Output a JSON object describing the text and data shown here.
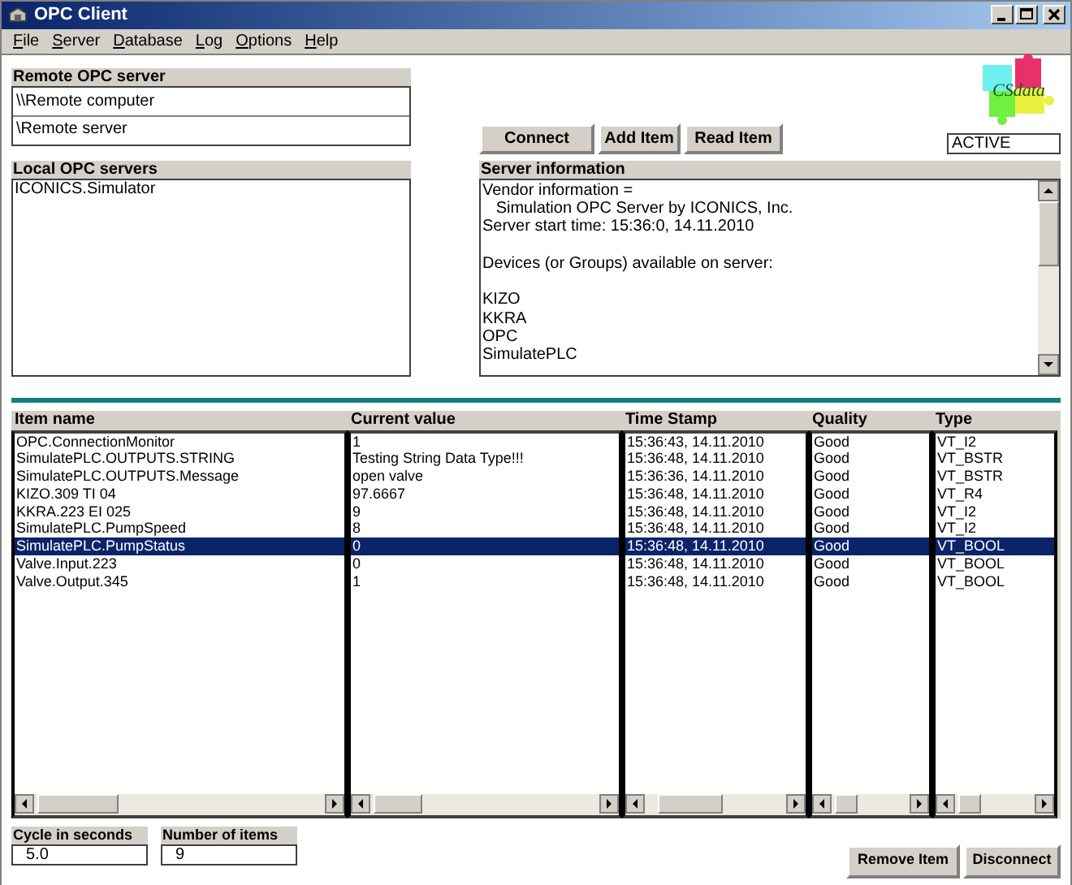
{
  "window": {
    "title": "OPC Client"
  },
  "menu": [
    "File",
    "Server",
    "Database",
    "Log",
    "Options",
    "Help"
  ],
  "remote_server": {
    "title": "Remote OPC server",
    "computer": "\\\\Remote computer",
    "server": "\\Remote server"
  },
  "local_servers": {
    "title": "Local OPC servers",
    "items": [
      {
        "label": "ICONICS.Simulator",
        "selected": false
      }
    ]
  },
  "buttons": [
    "Connect",
    "Add Item",
    "Read Item"
  ],
  "logo_text": "CSdata",
  "status_field": "ACTIVE",
  "server_info": {
    "title": "Server information",
    "paragraphs": [
      [
        "Vendor information =",
        "   Simulation OPC Server by ICONICS, Inc.",
        "Server start time: 15:36:0, 14.11.2010"
      ],
      [
        "Devices (or Groups) available on server:"
      ],
      [
        "KIZO",
        "KKRA",
        "OPC",
        "SimulatePLC"
      ]
    ]
  },
  "table": {
    "columns": [
      "Item name",
      "Current value",
      "Time Stamp",
      "Quality",
      "Type"
    ],
    "rows": [
      {
        "cells": [
          "OPC.ConnectionMonitor",
          "1",
          "15:36:43, 14.11.2010",
          "Good",
          "VT_I2"
        ],
        "selected": false
      },
      {
        "cells": [
          "SimulatePLC.OUTPUTS.STRING",
          "Testing String Data Type!!!",
          "15:36:48, 14.11.2010",
          "Good",
          "VT_BSTR"
        ],
        "selected": false
      },
      {
        "cells": [
          "SimulatePLC.OUTPUTS.Message",
          "open valve",
          "15:36:36, 14.11.2010",
          "Good",
          "VT_BSTR"
        ],
        "selected": false
      },
      {
        "cells": [
          "KIZO.309 TI 04",
          "97.6667",
          "15:36:48, 14.11.2010",
          "Good",
          "VT_R4"
        ],
        "selected": false
      },
      {
        "cells": [
          "KKRA.223 EI 025",
          "9",
          "15:36:48, 14.11.2010",
          "Good",
          "VT_I2"
        ],
        "selected": false
      },
      {
        "cells": [
          "SimulatePLC.PumpSpeed",
          "8",
          "15:36:48, 14.11.2010",
          "Good",
          "VT_I2"
        ],
        "selected": false
      },
      {
        "cells": [
          "SimulatePLC.PumpStatus",
          "0",
          "15:36:48, 14.11.2010",
          "Good",
          "VT_BOOL"
        ],
        "selected": true
      },
      {
        "cells": [
          "Valve.Input.223",
          "0",
          "15:36:48, 14.11.2010",
          "Good",
          "VT_BOOL"
        ],
        "selected": false
      },
      {
        "cells": [
          "Valve.Output.345",
          "1",
          "15:36:48, 14.11.2010",
          "Good",
          "VT_BOOL"
        ],
        "selected": false
      }
    ]
  },
  "cycle": {
    "label": "Cycle in seconds",
    "value": "5.0"
  },
  "item_count": {
    "label": "Number of items",
    "value": "9"
  },
  "bottom_buttons": [
    "Remove Item",
    "Disconnect"
  ]
}
